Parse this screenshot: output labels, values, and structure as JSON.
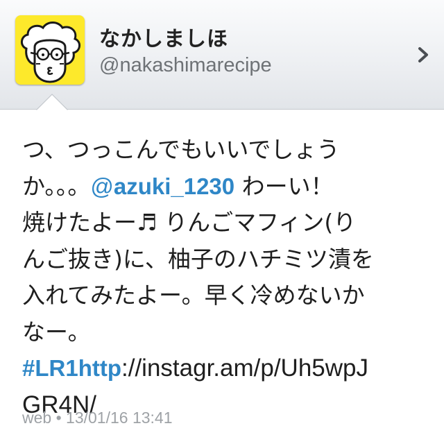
{
  "profile": {
    "display_name": "なかしましほ",
    "handle": "@nakashimarecipe",
    "avatar_icon": "cartoon-face-avatar",
    "avatar_color": "#fde92b"
  },
  "header": {
    "chevron_icon": "chevron-right-icon"
  },
  "tweet": {
    "line1": "つ、つっこんでもいいでしょう",
    "line2_pre": "か。。。",
    "mention_at": "@",
    "mention_name": "azuki_1230",
    "line2_post": " わーい！",
    "line3_text": "焼けたよー♬ りんごマフィン(り",
    "line4": "んご抜き)に、柚子のハチミツ漬を",
    "line5": "入れてみたよー。早く冷めないか",
    "line6": "なー。",
    "hashtag": "#LR1http",
    "url_part1": "://instagr.am/p/Uh5wpJ",
    "url_part2": "GR4N/",
    "link_color": "#2f87c7"
  },
  "meta": {
    "text": "web • 13/01/16 13:41"
  }
}
